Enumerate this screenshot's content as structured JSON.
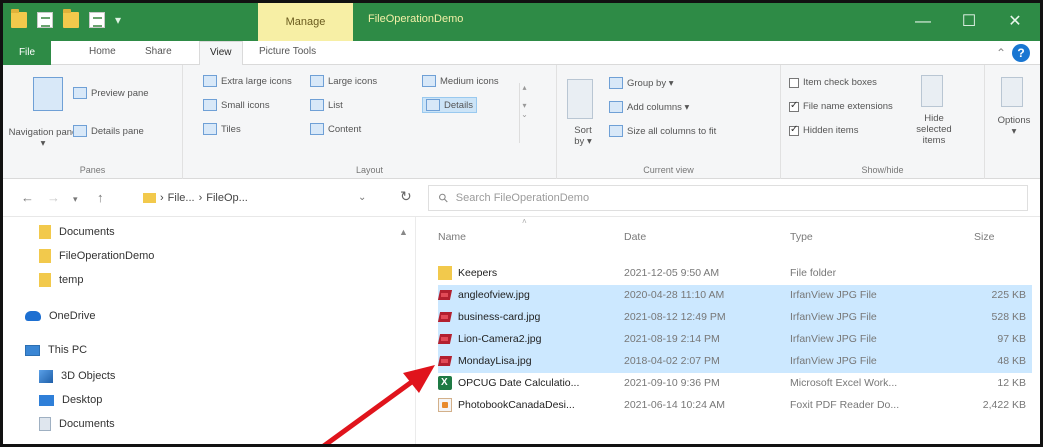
{
  "title_bar": {
    "manage_label": "Manage",
    "window_title": "FileOperationDemo",
    "minimize": "—",
    "maximize": "☐",
    "close": "✕"
  },
  "tabs": {
    "file": "File",
    "home": "Home",
    "share": "Share",
    "view": "View",
    "picture_tools": "Picture Tools"
  },
  "ribbon": {
    "panes": {
      "navigation_pane": "Navigation pane ▾",
      "preview_pane": "Preview pane",
      "details_pane": "Details pane",
      "label": "Panes"
    },
    "layout": {
      "extra_large": "Extra large icons",
      "large": "Large icons",
      "medium": "Medium icons",
      "small": "Small icons",
      "list": "List",
      "details": "Details",
      "tiles": "Tiles",
      "content": "Content",
      "label": "Layout"
    },
    "current_view": {
      "sort_by": "Sort by ▾",
      "group_by": "Group by ▾",
      "add_columns": "Add columns ▾",
      "size_all": "Size all columns to fit",
      "label": "Current view"
    },
    "show_hide": {
      "item_check_boxes": "Item check boxes",
      "file_name_extensions": "File name extensions",
      "hidden_items": "Hidden items",
      "hide_selected": "Hide selected items",
      "label": "Show/hide"
    },
    "options": "Options"
  },
  "address": {
    "crumbs": [
      "File...",
      "FileOp..."
    ],
    "search_placeholder": "Search FileOperationDemo"
  },
  "nav_pane": {
    "items": [
      {
        "label": "Documents",
        "icon": "folder-icon"
      },
      {
        "label": "FileOperationDemo",
        "icon": "folder-icon"
      },
      {
        "label": "temp",
        "icon": "folder-icon"
      },
      {
        "label": "OneDrive",
        "icon": "onedrive-icon"
      },
      {
        "label": "This PC",
        "icon": "this-pc-icon"
      },
      {
        "label": "3D Objects",
        "icon": "3d-objects-icon"
      },
      {
        "label": "Desktop",
        "icon": "desktop-icon"
      },
      {
        "label": "Documents",
        "icon": "documents-icon"
      }
    ]
  },
  "file_list": {
    "columns": {
      "name": "Name",
      "date": "Date",
      "type": "Type",
      "size": "Size"
    },
    "rows": [
      {
        "name": "Keepers",
        "date": "2021-12-05 9:50 AM",
        "type": "File folder",
        "size": "",
        "icon": "folder",
        "selected": false
      },
      {
        "name": "angleofview.jpg",
        "date": "2020-04-28 11:10 AM",
        "type": "IrfanView JPG File",
        "size": "225 KB",
        "icon": "irfan",
        "selected": true
      },
      {
        "name": "business-card.jpg",
        "date": "2021-08-12 12:49 PM",
        "type": "IrfanView JPG File",
        "size": "528 KB",
        "icon": "irfan",
        "selected": true
      },
      {
        "name": "Lion-Camera2.jpg",
        "date": "2021-08-19 2:14 PM",
        "type": "IrfanView JPG File",
        "size": "97 KB",
        "icon": "irfan",
        "selected": true
      },
      {
        "name": "MondayLisa.jpg",
        "date": "2018-04-02 2:07 PM",
        "type": "IrfanView JPG File",
        "size": "48 KB",
        "icon": "irfan",
        "selected": true
      },
      {
        "name": "OPCUG Date Calculatio...",
        "date": "2021-09-10 9:36 PM",
        "type": "Microsoft Excel Work...",
        "size": "12 KB",
        "icon": "excel",
        "selected": false
      },
      {
        "name": "PhotobookCanadaDesi...",
        "date": "2021-06-14 10:24 AM",
        "type": "Foxit PDF Reader Do...",
        "size": "2,422 KB",
        "icon": "pdf",
        "selected": false
      }
    ]
  },
  "annotation_color": "#e0141c"
}
